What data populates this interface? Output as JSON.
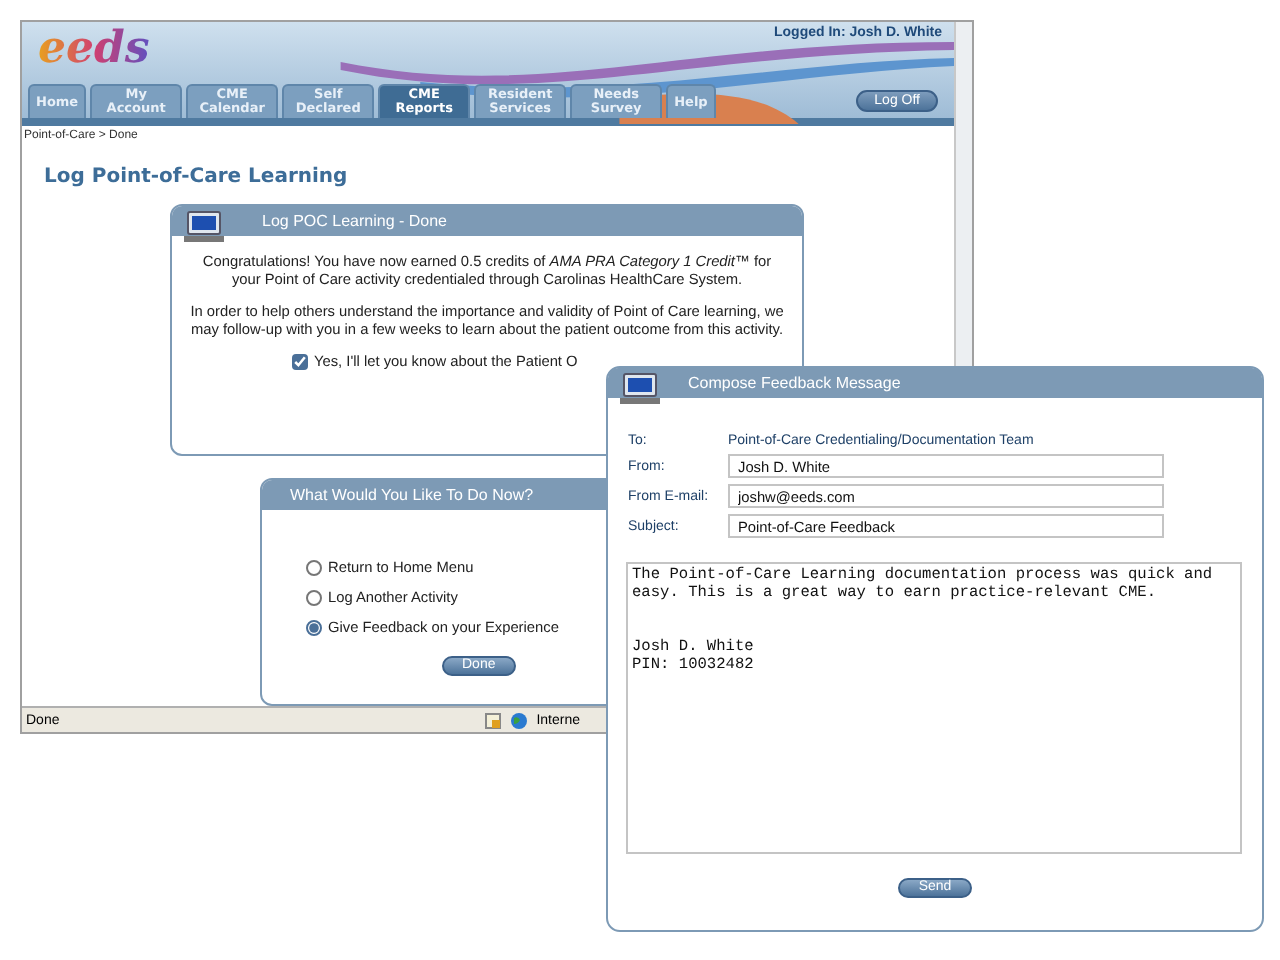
{
  "browser": {
    "header": {
      "logo": "eeds",
      "logged_in": "Logged In: Josh D. White",
      "log_off": "Log Off",
      "tabs": [
        {
          "label": "Home",
          "selected": false
        },
        {
          "label": "My Account",
          "selected": false
        },
        {
          "label": "CME Calendar",
          "selected": false
        },
        {
          "label": "Self Declared",
          "selected": false
        },
        {
          "label": "CME Reports",
          "selected": true
        },
        {
          "label": "Resident Services",
          "selected": false
        },
        {
          "label": "Needs Survey",
          "selected": false
        },
        {
          "label": "Help",
          "selected": false
        }
      ]
    },
    "breadcrumb": "Point-of-Care > Done",
    "page_title": "Log Point-of-Care Learning",
    "done_panel": {
      "title": "Log POC Learning - Done",
      "message": "Congratulations! You have now earned 0.5 credits of *AMA PRA Category 1 Credit™* for your Point of Care activity credentialed through Carolinas HealthCare System.",
      "note": "In order to help others understand the importance and validity of Point of Care learning, we may follow-up with you in a few weeks to learn about the patient outcome from this activity.",
      "checkbox": {
        "label": "Yes, I'll let you know about the Patient O",
        "checked": true
      }
    },
    "next_panel": {
      "title": "What Would You Like To Do Now?",
      "options": [
        {
          "label": "Return to Home Menu",
          "selected": false
        },
        {
          "label": "Log Another Activity",
          "selected": false
        },
        {
          "label": "Give Feedback on your Experience",
          "selected": true
        }
      ],
      "button": "Done"
    },
    "status_bar": {
      "text": "Done",
      "zone": "Interne"
    }
  },
  "feedback_dialog": {
    "title": "Compose Feedback Message",
    "to_label": "To:",
    "to_value": "Point-of-Care Credentialing/Documentation Team",
    "fields": [
      {
        "label": "From:",
        "value": "Josh D. White"
      },
      {
        "label": "From E-mail:",
        "value": "joshw@eeds.com"
      },
      {
        "label": "Subject:",
        "value": "Point-of-Care Feedback"
      }
    ],
    "message": "The Point-of-Care Learning documentation process was quick and easy. This is a great way to earn practice-relevant CME.\n\n\nJosh D. White\nPIN: 10032482",
    "send": "Send"
  }
}
